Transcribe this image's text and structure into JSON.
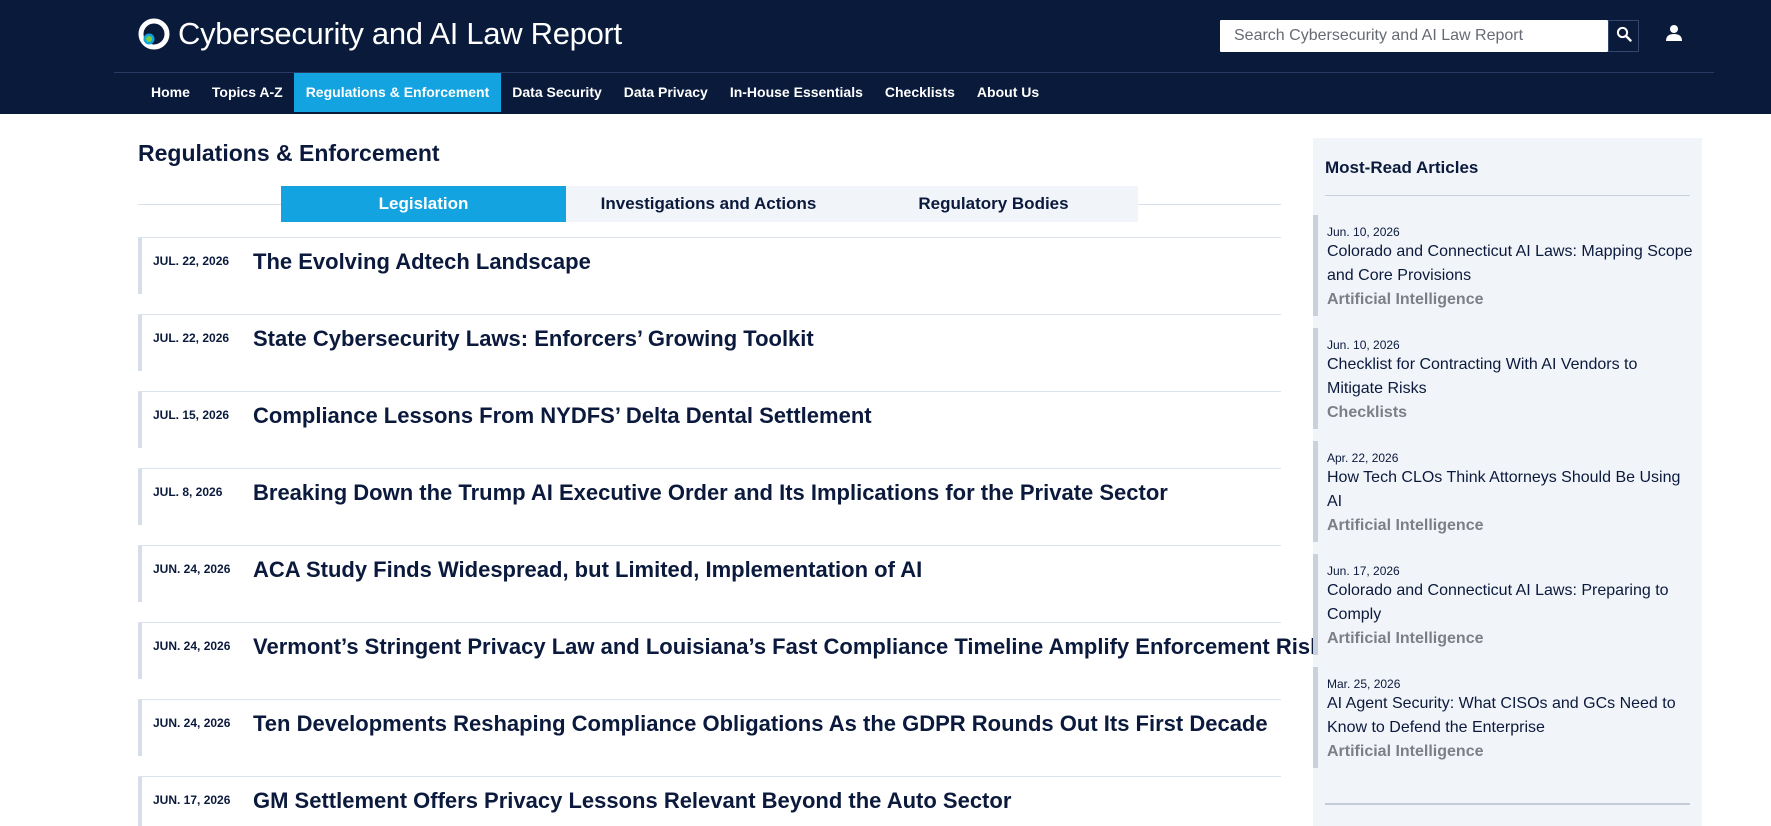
{
  "header": {
    "site_title": "Cybersecurity and AI Law Report",
    "search_placeholder": "Search Cybersecurity and AI Law Report",
    "search_icon": "search-icon",
    "user_icon": "user-icon",
    "colors": {
      "background": "#0a1a3a",
      "accent": "#13a3e0"
    }
  },
  "nav": {
    "items": [
      {
        "label": "Home",
        "active": false
      },
      {
        "label": "Topics A-Z",
        "active": false
      },
      {
        "label": "Regulations & Enforcement",
        "active": true
      },
      {
        "label": "Data Security",
        "active": false
      },
      {
        "label": "Data Privacy",
        "active": false
      },
      {
        "label": "In-House Essentials",
        "active": false
      },
      {
        "label": "Checklists",
        "active": false
      },
      {
        "label": "About Us",
        "active": false
      }
    ]
  },
  "main": {
    "page_title": "Regulations & Enforcement",
    "tabs": [
      {
        "label": "Legislation",
        "active": true
      },
      {
        "label": "Investigations and Actions",
        "active": false
      },
      {
        "label": "Regulatory Bodies",
        "active": false
      }
    ],
    "articles": [
      {
        "date": "JUL. 22, 2026",
        "title": "The Evolving Adtech Landscape"
      },
      {
        "date": "JUL. 22, 2026",
        "title": "State Cybersecurity Laws: Enforcers’ Growing Toolkit"
      },
      {
        "date": "JUL. 15, 2026",
        "title": "Compliance Lessons From NYDFS’ Delta Dental Settlement"
      },
      {
        "date": "JUL. 8, 2026",
        "title": "Breaking Down the Trump AI Executive Order and Its Implications for the Private Sector"
      },
      {
        "date": "JUN. 24, 2026",
        "title": "ACA Study Finds Widespread, but Limited, Implementation of AI"
      },
      {
        "date": "JUN. 24, 2026",
        "title": "Vermont’s Stringent Privacy Law and Louisiana’s Fast Compliance Timeline Amplify Enforcement Risk"
      },
      {
        "date": "JUN. 24, 2026",
        "title": "Ten Developments Reshaping Compliance Obligations As the GDPR Rounds Out Its First Decade"
      },
      {
        "date": "JUN. 17, 2026",
        "title": "GM Settlement Offers Privacy Lessons Relevant Beyond the Auto Sector"
      }
    ]
  },
  "sidebar": {
    "title": "Most-Read Articles",
    "items": [
      {
        "date": "Jun. 10, 2026",
        "title": "Colorado and Connecticut AI Laws: Mapping Scope and Core Provisions",
        "category": "Artificial Intelligence"
      },
      {
        "date": "Jun. 10, 2026",
        "title": "Checklist for Contracting With AI Vendors to Mitigate Risks",
        "category": "Checklists"
      },
      {
        "date": "Apr. 22, 2026",
        "title": "How Tech CLOs Think Attorneys Should Be Using AI",
        "category": "Artificial Intelligence"
      },
      {
        "date": "Jun. 17, 2026",
        "title": "Colorado and Connecticut AI Laws: Preparing to Comply",
        "category": "Artificial Intelligence"
      },
      {
        "date": "Mar. 25, 2026",
        "title": "AI Agent Security: What CISOs and GCs Need to Know to Defend the Enterprise",
        "category": "Artificial Intelligence"
      }
    ]
  }
}
